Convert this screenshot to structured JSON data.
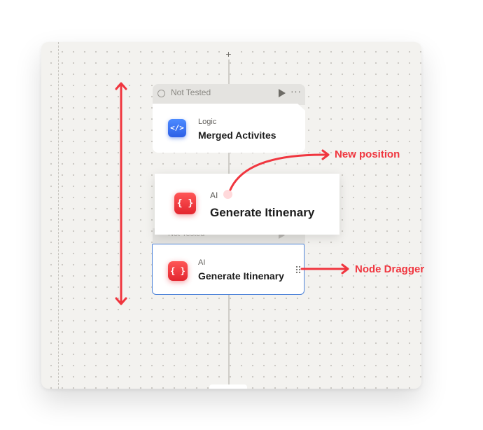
{
  "canvas": {
    "add_label": "+"
  },
  "node_logic": {
    "status": "Not Tested",
    "category": "Logic",
    "title": "Merged Activites",
    "icon_glyph": "</>",
    "more_glyph": "···"
  },
  "ghost_node": {
    "status": "Not Tested"
  },
  "dragged_node": {
    "category": "AI",
    "title": "Generate Itinenary",
    "icon_glyph": "{ }"
  },
  "node_ai": {
    "category": "AI",
    "title": "Generate Itinenary",
    "icon_glyph": "{ }"
  },
  "annotations": {
    "new_position": "New position",
    "node_dragger": "Node Dragger"
  },
  "colors": {
    "annotation": "#f0363f",
    "logic_icon": "#2d5fe6",
    "ai_icon": "#e3262f",
    "selection": "#4f84d9"
  }
}
